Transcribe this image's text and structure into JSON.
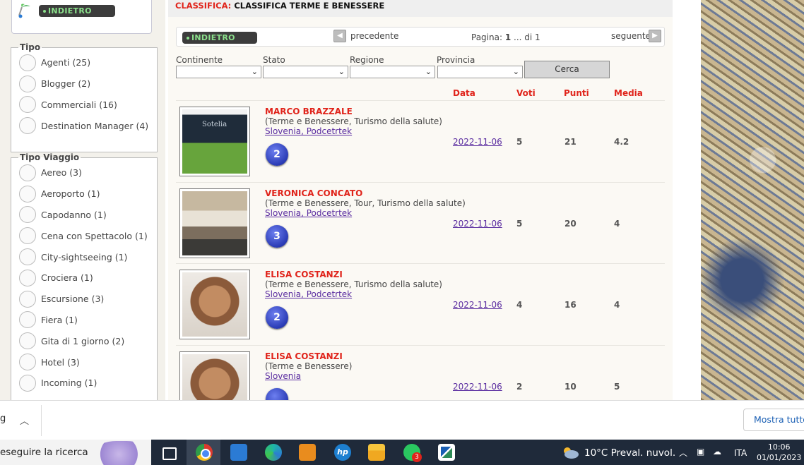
{
  "sidebar": {
    "back_label": "INDIETRO",
    "tipo": {
      "legend": "Tipo",
      "options": [
        "Agenti (25)",
        "Blogger (2)",
        "Commerciali (16)",
        "Destination Manager (4)"
      ]
    },
    "tipo_viaggio": {
      "legend": "Tipo Viaggio",
      "options": [
        "Aereo (3)",
        "Aeroporto (1)",
        "Capodanno (1)",
        "Cena con Spettacolo (1)",
        "City-sightseeing (1)",
        "Crociera (1)",
        "Escursione (3)",
        "Fiera (1)",
        "Gita di 1 giorno (2)",
        "Hotel (3)",
        "Incoming (1)"
      ]
    }
  },
  "header": {
    "prefix": "CLASSIFICA:",
    "title": "CLASSIFICA TERME E BENESSERE"
  },
  "pager": {
    "back_label": "INDIETRO",
    "prev_label": "precedente",
    "page_prefix": "Pagina:",
    "page_current": "1",
    "page_suffix": "... di 1",
    "next_label": "seguente"
  },
  "filters": {
    "continente": "Continente",
    "stato": "Stato",
    "regione": "Regione",
    "provincia": "Provincia",
    "search_button": "Cerca"
  },
  "table": {
    "headers": [
      "Data",
      "Voti",
      "Punti",
      "Media"
    ],
    "rows": [
      {
        "name": "MARCO BRAZZALE",
        "categories": "(Terme e Benessere, Turismo della salute)",
        "location": "Slovenia, Podcetrtek",
        "badge": "2",
        "date": "2022-11-06",
        "voti": "5",
        "punti": "21",
        "media": "4.2",
        "photo_text": "Sotelia"
      },
      {
        "name": "VERONICA CONCATO",
        "categories": "(Terme e Benessere, Tour, Turismo della salute)",
        "location": "Slovenia, Podcetrtek",
        "badge": "3",
        "date": "2022-11-06",
        "voti": "5",
        "punti": "20",
        "media": "4"
      },
      {
        "name": "ELISA COSTANZI",
        "categories": "(Terme e Benessere, Turismo della salute)",
        "location": "Slovenia, Podcetrtek",
        "badge": "2",
        "date": "2022-11-06",
        "voti": "4",
        "punti": "16",
        "media": "4"
      },
      {
        "name": "ELISA COSTANZI",
        "categories": "(Terme e Benessere)",
        "location": "Slovenia",
        "badge": "",
        "date": "2022-11-06",
        "voti": "2",
        "punti": "10",
        "media": "5"
      }
    ]
  },
  "download_bar": {
    "item": "g",
    "show_all": "Mostra tutto"
  },
  "taskbar": {
    "search_text": "eseguire la ricerca",
    "whatsapp_badge": "3",
    "weather": "10°C  Preval. nuvol.",
    "lang": "ITA",
    "time": "10:06",
    "date": "01/01/2023"
  },
  "colors": {
    "accent_red": "#e0241b",
    "link_purple": "#5a2ca0",
    "badge_blue": "#2a3bb5"
  }
}
